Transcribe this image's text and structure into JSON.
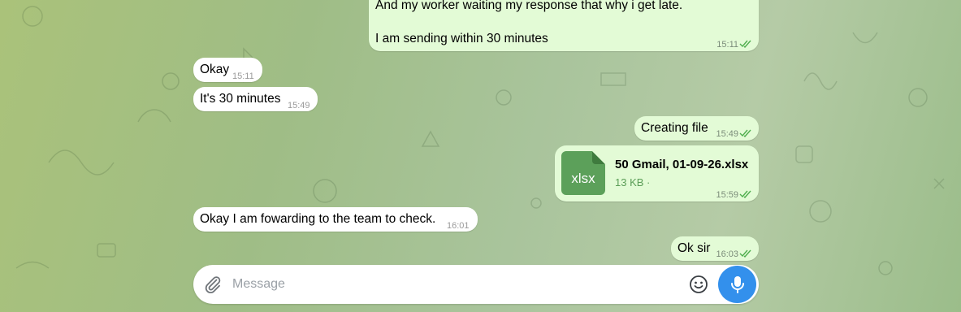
{
  "chat": {
    "messages": [
      {
        "id": "m1",
        "direction": "out",
        "lines": [
          "And my worker waiting my response that why i get late.",
          "",
          "I am sending within 30 minutes"
        ],
        "time": "15:11",
        "read": true
      },
      {
        "id": "m2",
        "direction": "in",
        "text": "Okay",
        "time": "15:11"
      },
      {
        "id": "m3",
        "direction": "in",
        "text": "It's 30 minutes",
        "time": "15:49"
      },
      {
        "id": "m4",
        "direction": "out",
        "text": "Creating file",
        "time": "15:49",
        "read": true
      },
      {
        "id": "m5",
        "direction": "out",
        "file": {
          "icon_label": "xlsx",
          "name": "50 Gmail, 01-09-26.xlsx",
          "size": "13 KB ·"
        },
        "time": "15:59",
        "read": true
      },
      {
        "id": "m6",
        "direction": "in",
        "text": "Okay I am fowarding to the team to check.",
        "time": "16:01"
      },
      {
        "id": "m7",
        "direction": "out",
        "text": "Ok sir",
        "time": "16:03",
        "read": true
      }
    ]
  },
  "composer": {
    "placeholder": "Message",
    "attach_icon": "paperclip-icon",
    "emoji_icon": "smiley-icon",
    "send_icon": "microphone-icon"
  },
  "colors": {
    "outgoing_bubble": "#e3fbd6",
    "incoming_bubble": "#ffffff",
    "accent": "#3390ec",
    "file_icon": "#5ca05a"
  }
}
